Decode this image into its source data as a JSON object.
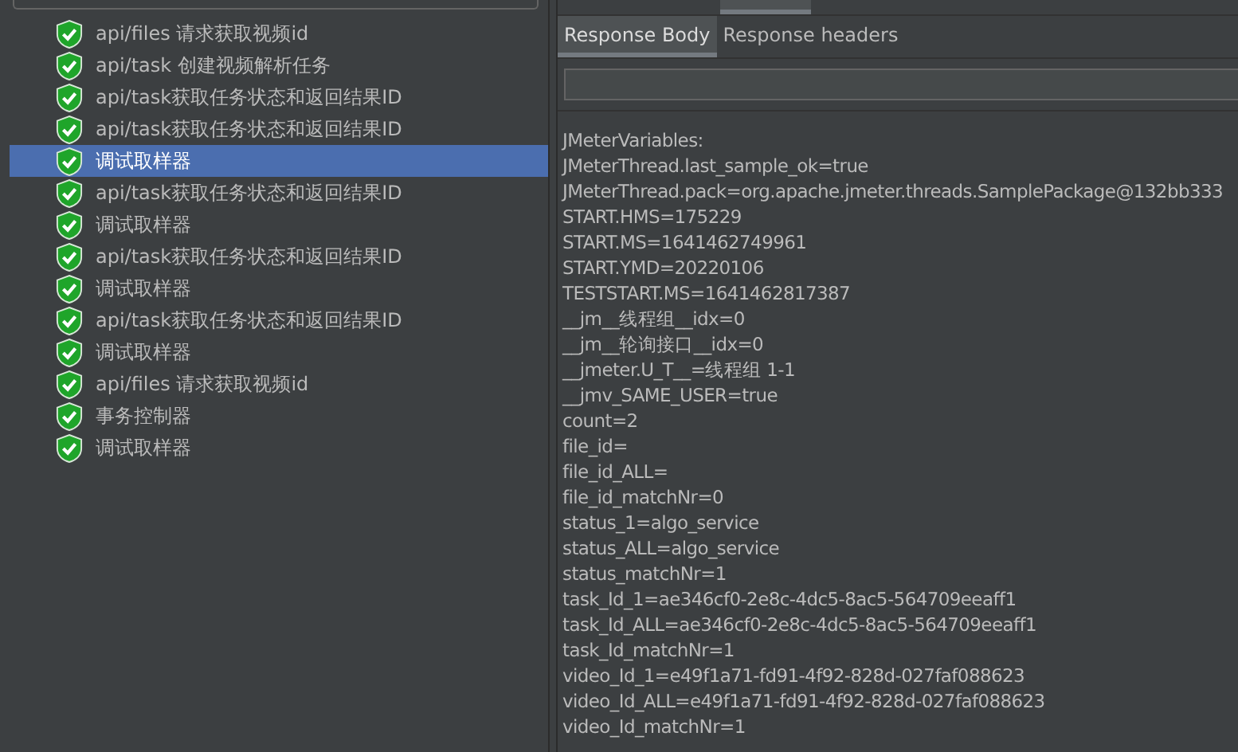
{
  "tree": {
    "items": [
      {
        "label": "api/files 请求获取视频id",
        "passed": true,
        "selected": false
      },
      {
        "label": "api/task 创建视频解析任务",
        "passed": true,
        "selected": false
      },
      {
        "label": "api/task获取任务状态和返回结果ID",
        "passed": true,
        "selected": false
      },
      {
        "label": "api/task获取任务状态和返回结果ID",
        "passed": true,
        "selected": false
      },
      {
        "label": "调试取样器",
        "passed": true,
        "selected": true
      },
      {
        "label": "api/task获取任务状态和返回结果ID",
        "passed": true,
        "selected": false
      },
      {
        "label": "调试取样器",
        "passed": true,
        "selected": false
      },
      {
        "label": "api/task获取任务状态和返回结果ID",
        "passed": true,
        "selected": false
      },
      {
        "label": "调试取样器",
        "passed": true,
        "selected": false
      },
      {
        "label": "api/task获取任务状态和返回结果ID",
        "passed": true,
        "selected": false
      },
      {
        "label": "调试取样器",
        "passed": true,
        "selected": false
      },
      {
        "label": "api/files 请求获取视频id",
        "passed": true,
        "selected": false
      },
      {
        "label": "事务控制器",
        "passed": true,
        "selected": false
      },
      {
        "label": "调试取样器",
        "passed": true,
        "selected": false
      }
    ]
  },
  "response_tabs": [
    {
      "label": "Response Body",
      "selected": true
    },
    {
      "label": "Response headers",
      "selected": false
    }
  ],
  "response_body": [
    "JMeterVariables:",
    "JMeterThread.last_sample_ok=true",
    "JMeterThread.pack=org.apache.jmeter.threads.SamplePackage@132bb333",
    "START.HMS=175229",
    "START.MS=1641462749961",
    "START.YMD=20220106",
    "TESTSTART.MS=1641462817387",
    "__jm__线程组__idx=0",
    "__jm__轮询接口__idx=0",
    "__jmeter.U_T__=线程组 1-1",
    "__jmv_SAME_USER=true",
    "count=2",
    "file_id=",
    "file_id_ALL=",
    "file_id_matchNr=0",
    "status_1=algo_service",
    "status_ALL=algo_service",
    "status_matchNr=1",
    "task_Id_1=ae346cf0-2e8c-4dc5-8ac5-564709eeaff1",
    "task_Id_ALL=ae346cf0-2e8c-4dc5-8ac5-564709eeaff1",
    "task_Id_matchNr=1",
    "video_Id_1=e49f1a71-fd91-4f92-828d-027faf088623",
    "video_Id_ALL=e49f1a71-fd91-4f92-828d-027faf088623",
    "video_Id_matchNr=1"
  ]
}
